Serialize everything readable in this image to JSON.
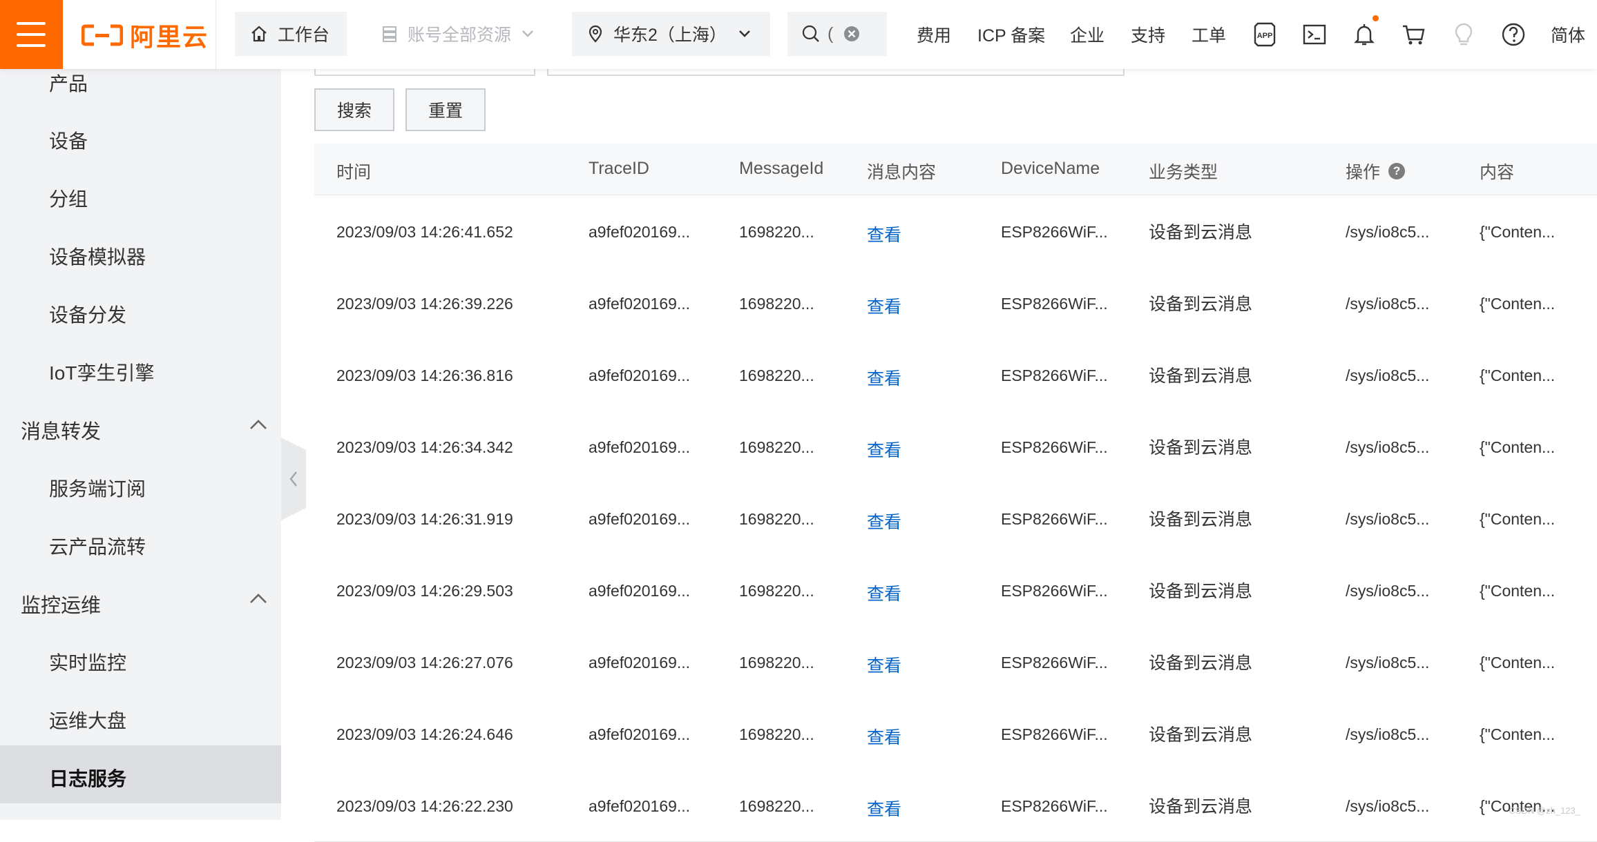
{
  "topbar": {
    "logo_text": "阿里云",
    "workbench": "工作台",
    "resources": "账号全部资源",
    "region": "华东2（上海）",
    "search_partial": "(",
    "links": [
      "费用",
      "ICP 备案",
      "企业",
      "支持",
      "工单"
    ],
    "lang": "简体",
    "icons": [
      "app-icon",
      "terminal-icon",
      "bell-icon",
      "cart-icon",
      "lightbulb-icon",
      "help-icon"
    ]
  },
  "sidebar": {
    "items_top": [
      "产品",
      "设备",
      "分组",
      "设备模拟器",
      "设备分发",
      "IoT孪生引擎"
    ],
    "group_forward": "消息转发",
    "forward_items": [
      "服务端订阅",
      "云产品流转"
    ],
    "group_monitor": "监控运维",
    "monitor_items": [
      "实时监控",
      "运维大盘",
      "日志服务"
    ],
    "active_item": "日志服务"
  },
  "main": {
    "search_button": "搜索",
    "reset_button": "重置",
    "columns": [
      "时间",
      "TraceID",
      "MessageId",
      "消息内容",
      "DeviceName",
      "业务类型",
      "操作",
      "内容"
    ],
    "rows": [
      {
        "time": "2023/09/03 14:26:41.652",
        "trace": "a9fef020169...",
        "msgid": "1698220...",
        "view": "查看",
        "device": "ESP8266WiF...",
        "biz": "设备到云消息",
        "op": "/sys/io8c5...",
        "content": "{\"Conten..."
      },
      {
        "time": "2023/09/03 14:26:39.226",
        "trace": "a9fef020169...",
        "msgid": "1698220...",
        "view": "查看",
        "device": "ESP8266WiF...",
        "biz": "设备到云消息",
        "op": "/sys/io8c5...",
        "content": "{\"Conten..."
      },
      {
        "time": "2023/09/03 14:26:36.816",
        "trace": "a9fef020169...",
        "msgid": "1698220...",
        "view": "查看",
        "device": "ESP8266WiF...",
        "biz": "设备到云消息",
        "op": "/sys/io8c5...",
        "content": "{\"Conten..."
      },
      {
        "time": "2023/09/03 14:26:34.342",
        "trace": "a9fef020169...",
        "msgid": "1698220...",
        "view": "查看",
        "device": "ESP8266WiF...",
        "biz": "设备到云消息",
        "op": "/sys/io8c5...",
        "content": "{\"Conten..."
      },
      {
        "time": "2023/09/03 14:26:31.919",
        "trace": "a9fef020169...",
        "msgid": "1698220...",
        "view": "查看",
        "device": "ESP8266WiF...",
        "biz": "设备到云消息",
        "op": "/sys/io8c5...",
        "content": "{\"Conten..."
      },
      {
        "time": "2023/09/03 14:26:29.503",
        "trace": "a9fef020169...",
        "msgid": "1698220...",
        "view": "查看",
        "device": "ESP8266WiF...",
        "biz": "设备到云消息",
        "op": "/sys/io8c5...",
        "content": "{\"Conten..."
      },
      {
        "time": "2023/09/03 14:26:27.076",
        "trace": "a9fef020169...",
        "msgid": "1698220...",
        "view": "查看",
        "device": "ESP8266WiF...",
        "biz": "设备到云消息",
        "op": "/sys/io8c5...",
        "content": "{\"Conten..."
      },
      {
        "time": "2023/09/03 14:26:24.646",
        "trace": "a9fef020169...",
        "msgid": "1698220...",
        "view": "查看",
        "device": "ESP8266WiF...",
        "biz": "设备到云消息",
        "op": "/sys/io8c5...",
        "content": "{\"Conten..."
      },
      {
        "time": "2023/09/03 14:26:22.230",
        "trace": "a9fef020169...",
        "msgid": "1698220...",
        "view": "查看",
        "device": "ESP8266WiF...",
        "biz": "设备到云消息",
        "op": "/sys/io8c5...",
        "content": "{\"Conten..."
      }
    ]
  },
  "watermark": "CSDN @zh_123_",
  "colors": {
    "brand": "#ff6a00",
    "link": "#0064c8",
    "sidebar_bg": "#f2f3f5",
    "active_bg": "#dcdee2"
  }
}
